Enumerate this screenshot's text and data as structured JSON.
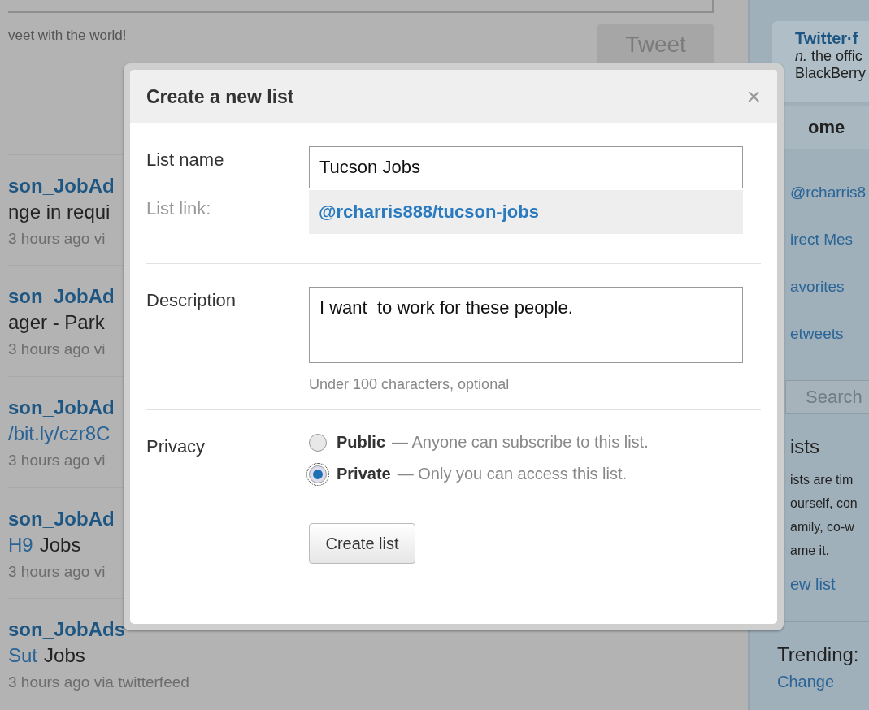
{
  "compose": {
    "hint": "veet with the world!",
    "button": "Tweet"
  },
  "tweets": [
    {
      "author": "son_JobAd",
      "body": [
        {
          "kind": "text",
          "text": "nge in requi"
        }
      ],
      "meta": "3 hours ago vi"
    },
    {
      "author": "son_JobAd",
      "body": [
        {
          "kind": "text",
          "text": "ager - Park"
        }
      ],
      "meta": "3 hours ago vi"
    },
    {
      "author": "son_JobAd",
      "body": [
        {
          "kind": "link",
          "text": "/bit.ly/czr8C"
        }
      ],
      "meta": "3 hours ago vi"
    },
    {
      "author": "son_JobAd",
      "body": [
        {
          "kind": "link",
          "text": "H9"
        },
        {
          "kind": "text",
          "text": "Jobs"
        }
      ],
      "meta": "3 hours ago vi"
    },
    {
      "author": "son_JobAds",
      "body": [
        {
          "kind": "link",
          "text": "Sut"
        },
        {
          "kind": "text",
          "text": "Jobs"
        }
      ],
      "meta": "3 hours ago via twitterfeed"
    }
  ],
  "sidebar": {
    "promo": {
      "title": "Twitter·f",
      "lines": [
        "*n.* the offic",
        "BlackBerry"
      ]
    },
    "home": "ome",
    "links": [
      "@rcharris8",
      "irect Mes",
      "avorites",
      "etweets"
    ],
    "search": {
      "placeholder": "Search"
    },
    "lists_title": "ists",
    "lists_text": [
      "ists are tim",
      "ourself, con",
      "amily, co-w",
      "ame it."
    ],
    "new_list": "ew list",
    "trending": "Trending:",
    "change": "Change"
  },
  "dialog": {
    "title": "Create a new list",
    "close": "×",
    "name_label": "List name",
    "name_value": "Tucson Jobs",
    "link_label": "List link:",
    "link_value": "@rcharris888/tucson-jobs",
    "description_label": "Description",
    "description_value": "I want  to work for these people.",
    "description_hint": "Under 100 characters, optional",
    "privacy_label": "Privacy",
    "privacy_options": [
      {
        "name": "Public",
        "note": "— Anyone can subscribe to this list.",
        "selected": false
      },
      {
        "name": "Private",
        "note": "— Only you can access this list.",
        "selected": true
      }
    ],
    "submit": "Create list"
  }
}
